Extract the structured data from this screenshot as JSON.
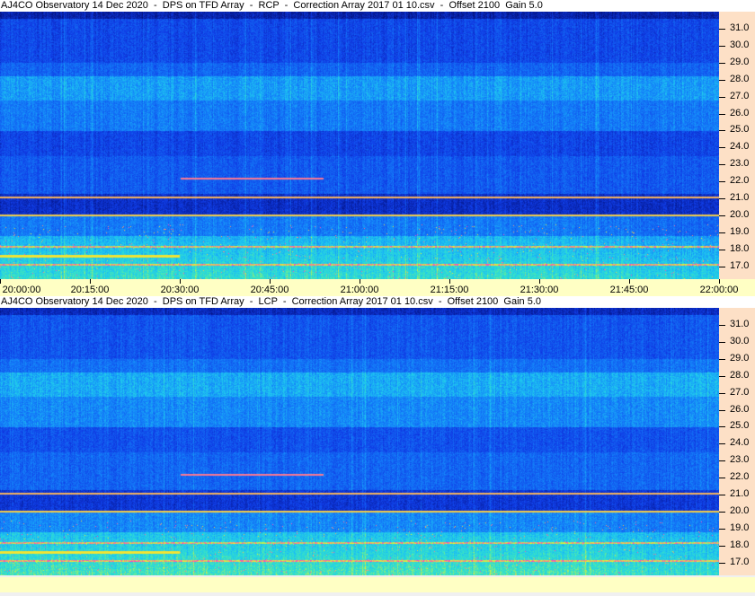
{
  "panels": [
    {
      "title": "AJ4CO Observatory 14 Dec 2020  -  DPS on TFD Array  -  RCP  -  Correction Array 2017 01 10.csv  -  Offset 2100  Gain 5.0",
      "polarization": "RCP"
    },
    {
      "title": "AJ4CO Observatory 14 Dec 2020  -  DPS on TFD Array  -  LCP  -  Correction Array 2017 01 10.csv  -  Offset 2100  Gain 5.0",
      "polarization": "LCP"
    }
  ],
  "freq_ticks": [
    "31.0",
    "30.0",
    "29.0",
    "28.0",
    "27.0",
    "26.0",
    "25.0",
    "24.0",
    "23.0",
    "22.0",
    "21.0",
    "20.0",
    "19.0",
    "18.0",
    "17.0"
  ],
  "time_ticks": [
    "20:00:00",
    "20:15:00",
    "20:30:00",
    "20:45:00",
    "21:00:00",
    "21:15:00",
    "21:30:00",
    "21:45:00",
    "22:00:00"
  ]
}
